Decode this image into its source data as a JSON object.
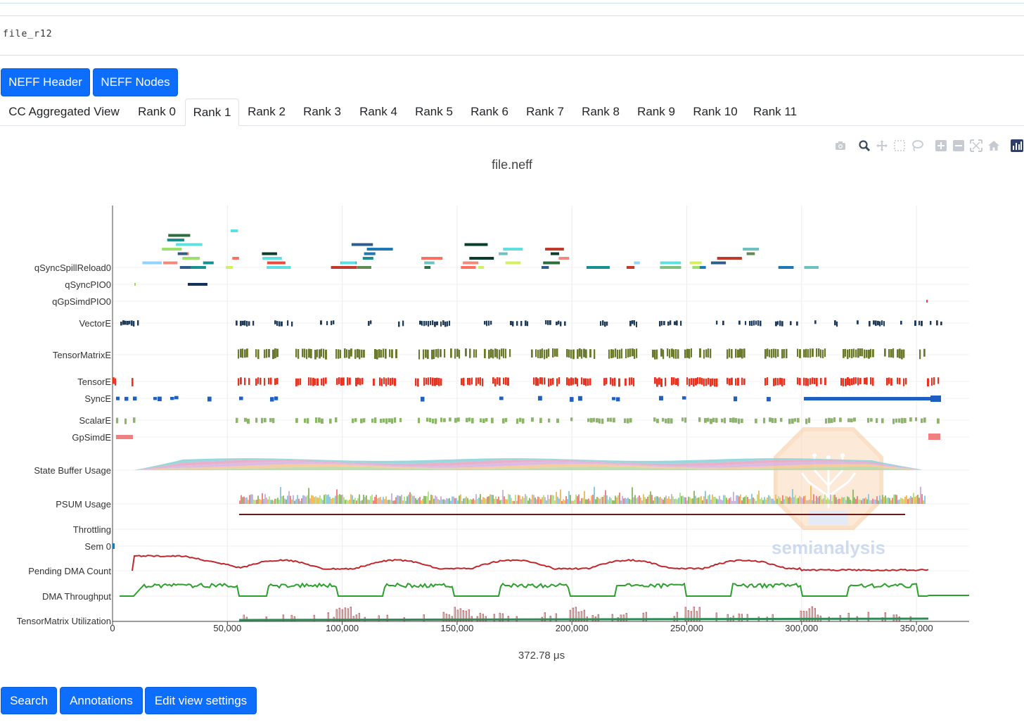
{
  "file_input": {
    "value": "file_r12"
  },
  "top_buttons": {
    "neff_header": "NEFF Header",
    "neff_nodes": "NEFF Nodes"
  },
  "tabs": [
    {
      "label": "CC Aggregated View",
      "active": false
    },
    {
      "label": "Rank 0",
      "active": false
    },
    {
      "label": "Rank 1",
      "active": true
    },
    {
      "label": "Rank 2",
      "active": false
    },
    {
      "label": "Rank 3",
      "active": false
    },
    {
      "label": "Rank 4",
      "active": false
    },
    {
      "label": "Rank 5",
      "active": false
    },
    {
      "label": "Rank 6",
      "active": false
    },
    {
      "label": "Rank 7",
      "active": false
    },
    {
      "label": "Rank 8",
      "active": false
    },
    {
      "label": "Rank 9",
      "active": false
    },
    {
      "label": "Rank 10",
      "active": false
    },
    {
      "label": "Rank 11",
      "active": false
    }
  ],
  "modebar": [
    "camera-icon",
    "zoom-icon",
    "pan-icon",
    "box-select-icon",
    "lasso-icon",
    "zoom-in-icon",
    "zoom-out-icon",
    "autoscale-icon",
    "reset-axes-icon",
    "plotly-logo-icon"
  ],
  "chart_data": {
    "type": "timeline",
    "title": "file.neff",
    "xlabel": "372.78 μs",
    "xlim": [
      0,
      372780
    ],
    "xticks": [
      0,
      50000,
      100000,
      150000,
      200000,
      250000,
      300000,
      350000
    ],
    "xtick_labels": [
      "0",
      "50,000",
      "100,000",
      "150,000",
      "200,000",
      "250,000",
      "300,000",
      "350,000"
    ],
    "rows": [
      "qSyncSpillReload0",
      "qSyncPIO0",
      "qGpSimdPIO0",
      "VectorE",
      "TensorMatrixE",
      "TensorE",
      "SyncE",
      "ScalarE",
      "GpSimdE",
      "State Buffer Usage",
      "PSUM Usage",
      "Throttling",
      "Sem 0",
      "Pending DMA Count",
      "DMA Throughput",
      "TensorMatrix Utilization"
    ],
    "colors": {
      "vector": "#1f3b5a",
      "tensor_matrix": "#6b7a2a",
      "tensor": "#e8321e",
      "sync": "#1f5fbf",
      "scalar": "#8db56a",
      "gpsimd": "#f08080",
      "pending_dma": "#c0272d",
      "dma_throughput": "#2ca02c",
      "throttling": "#6b1a1a",
      "tm_util": "#2e8b57"
    },
    "watermark": "semianalysis"
  },
  "bottom_buttons": {
    "search": "Search",
    "annotations": "Annotations",
    "edit_view": "Edit view settings"
  }
}
